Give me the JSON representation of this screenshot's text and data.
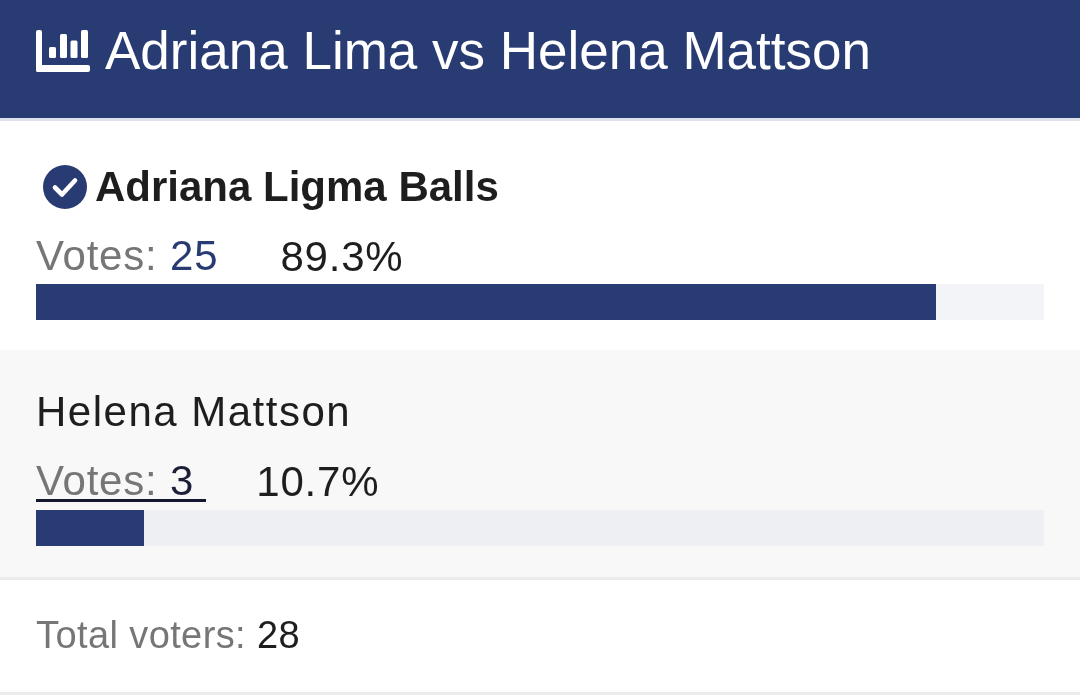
{
  "header": {
    "title": "Adriana Lima vs Helena Mattson"
  },
  "options": [
    {
      "name": "Adriana Ligma Balls",
      "selected": true,
      "votes_label": "Votes:",
      "votes": "25",
      "focused": false,
      "percent": "89.3%",
      "level": 0.893
    },
    {
      "name": "Helena Mattson",
      "selected": false,
      "votes_label": "Votes:",
      "votes": "3",
      "focused": true,
      "percent": "10.7%",
      "level": 0.107
    }
  ],
  "footer": {
    "label": "Total voters:",
    "count": "28"
  }
}
